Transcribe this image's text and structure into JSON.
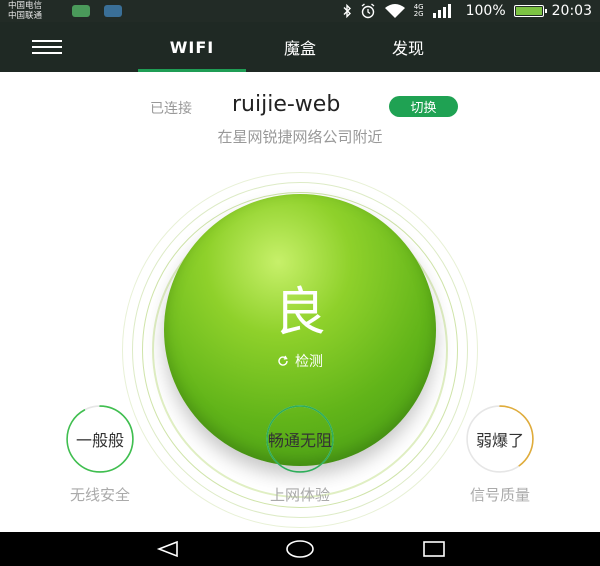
{
  "status_bar": {
    "carrier_1": "中国电信",
    "carrier_2": "中国联通",
    "net_1": "4G",
    "net_2": "2G",
    "battery": "100%",
    "time": "20:03",
    "icons": [
      "bluetooth-icon",
      "alarm-icon",
      "wifi-icon",
      "signal-icon",
      "battery-icon"
    ]
  },
  "header": {
    "tabs": [
      {
        "label": "WIFI",
        "active": true
      },
      {
        "label": "魔盒",
        "active": false
      },
      {
        "label": "发现",
        "active": false
      }
    ]
  },
  "connection": {
    "status_label": "已连接",
    "ssid": "ruijie-web",
    "switch_label": "切换",
    "location": "在星网锐捷网络公司附近"
  },
  "quality": {
    "grade": "良",
    "detect_label": "检测"
  },
  "metrics": [
    {
      "value": "一般般",
      "caption": "无线安全",
      "color": "#3fbf4f",
      "fraction": 0.92
    },
    {
      "value": "畅通无阻",
      "caption": "上网体验",
      "color": "#2eae5a",
      "fraction": 1.0
    },
    {
      "value": "弱爆了",
      "caption": "信号质量",
      "color": "#e0ac3a",
      "fraction": 0.4
    }
  ],
  "colors": {
    "accent": "#1fa253",
    "header_bg": "#1f2924",
    "orb": "#7cc22a"
  }
}
